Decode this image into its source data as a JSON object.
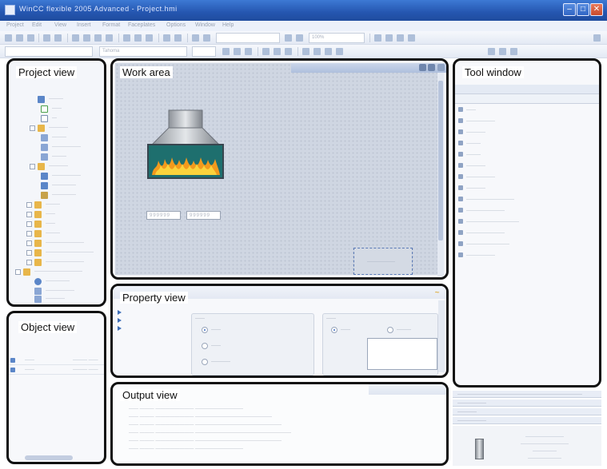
{
  "window": {
    "title": "WinCC flexible 2005 Advanced - Project.hmi"
  },
  "menu": [
    "Project",
    "Edit",
    "View",
    "Insert",
    "Format",
    "Faceplates",
    "Options",
    "Window",
    "Help"
  ],
  "toolbar": {
    "font_combo": "Tahoma",
    "zoom_combo": "100%"
  },
  "panels": {
    "project_view": {
      "label": "Project view"
    },
    "object_view": {
      "label": "Object view"
    },
    "work_area": {
      "label": "Work area"
    },
    "property_view": {
      "label": "Property view"
    },
    "output_view": {
      "label": "Output view"
    },
    "tool_window": {
      "label": "Tool window"
    }
  },
  "icons": {
    "app": "app-icon",
    "minimize": "minimize-icon",
    "maximize": "maximize-icon",
    "close": "close-icon"
  },
  "colors": {
    "titlebar": "#2556b0",
    "panel_outline": "#111111",
    "canvas": "#cfd6e2",
    "flame": "#f29a1d",
    "burner_fill": "#1e6f6e"
  }
}
